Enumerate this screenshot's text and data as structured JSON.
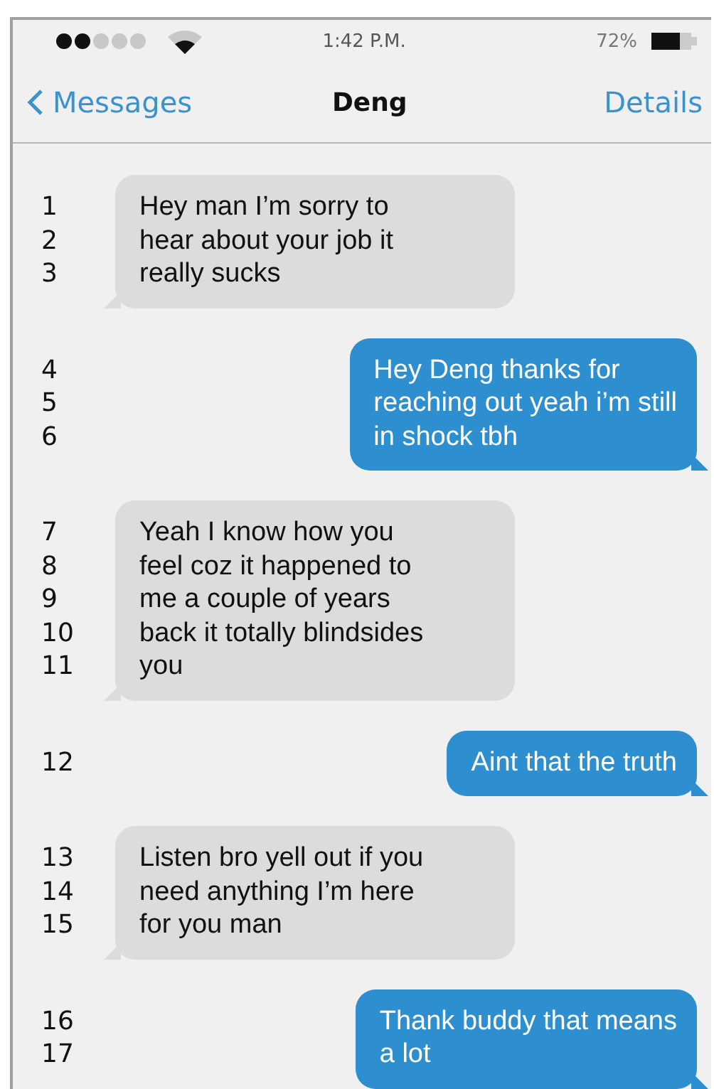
{
  "status_bar": {
    "time": "1:42 P.M.",
    "battery": "72%"
  },
  "nav": {
    "back": "Messages",
    "title": "Deng",
    "action": "Details"
  },
  "messages": [
    {
      "kind": "incoming",
      "numbers": [
        "1",
        "2",
        "3"
      ],
      "lines": [
        "Hey man I’m sorry to",
        "hear about your job it",
        "really sucks"
      ]
    },
    {
      "kind": "outgoing",
      "numbers": [
        "4",
        "5",
        "6"
      ],
      "lines": [
        "Hey Deng thanks for",
        "reaching out yeah i’m still",
        "in shock tbh"
      ]
    },
    {
      "kind": "incoming",
      "numbers": [
        "7",
        "8",
        "9",
        "10",
        "11"
      ],
      "lines": [
        "Yeah I know how you",
        "feel coz it happened to",
        "me a couple of years",
        "back it totally blindsides",
        "you"
      ]
    },
    {
      "kind": "outgoing",
      "numbers": [
        "12"
      ],
      "lines": [
        "Aint that the truth"
      ]
    },
    {
      "kind": "incoming",
      "numbers": [
        "13",
        "14",
        "15"
      ],
      "lines": [
        "Listen bro yell out if you",
        "need anything I’m here",
        "for you man"
      ]
    },
    {
      "kind": "outgoing",
      "numbers": [
        "16",
        "17"
      ],
      "lines": [
        "Thank buddy that means",
        "a lot"
      ]
    }
  ]
}
